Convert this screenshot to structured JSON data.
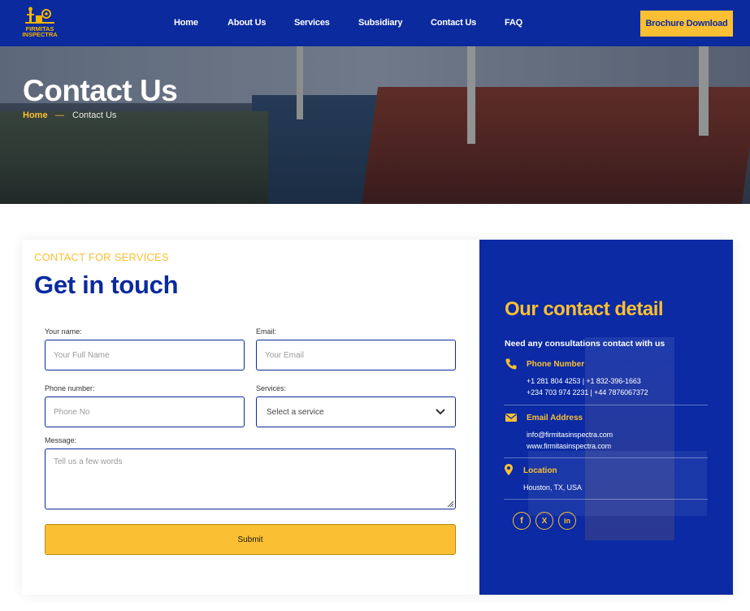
{
  "brand": {
    "logo_text": "FIRMITAS INSPECTRA",
    "colors": {
      "primary": "#0a2a9e",
      "accent": "#fbbf33"
    }
  },
  "nav": {
    "items": [
      {
        "label": "Home"
      },
      {
        "label": "About Us"
      },
      {
        "label": "Services"
      },
      {
        "label": "Subsidiary"
      },
      {
        "label": "Contact Us"
      },
      {
        "label": "FAQ"
      }
    ],
    "cta_label": "Brochure Download"
  },
  "hero": {
    "title": "Contact Us",
    "breadcrumb": {
      "home": "Home",
      "separator": "—",
      "current": "Contact Us"
    }
  },
  "form": {
    "eyebrow": "CONTACT FOR SERVICES",
    "heading": "Get in touch",
    "name_label": "Your name:",
    "name_placeholder": "Your Full Name",
    "email_label": "Email:",
    "email_placeholder": "Your Email",
    "phone_label": "Phone number:",
    "phone_placeholder": "Phone No",
    "services_label": "Services:",
    "services_selected": "Select a service",
    "message_label": "Message:",
    "message_placeholder": "Tell us a few words",
    "submit_label": "Submit"
  },
  "contact": {
    "heading": "Our contact detail",
    "subheading": "Need any consultations contact with us",
    "phone": {
      "title": "Phone Number",
      "line1": "+1 281 804 4253 | +1 832-396-1663",
      "line2": "+234 703 974 2231 | +44 7876067372",
      "icon": "phone-icon"
    },
    "email": {
      "title": "Email Address",
      "line1": "info@firmitasinspectra.com",
      "line2": "www.firmitasinspectra.com",
      "icon": "envelope-icon"
    },
    "location": {
      "title": "Location",
      "line1": "Houston, TX, USA",
      "icon": "map-pin-icon"
    },
    "social": [
      {
        "glyph": "f",
        "icon": "facebook-icon"
      },
      {
        "glyph": "X",
        "icon": "x-twitter-icon"
      },
      {
        "glyph": "in",
        "icon": "linkedin-icon"
      }
    ]
  }
}
